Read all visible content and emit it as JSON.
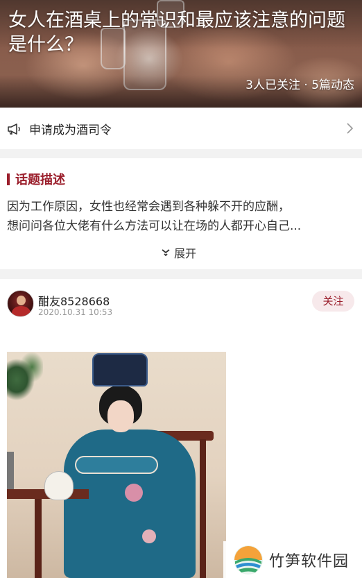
{
  "hero": {
    "title": "女人在酒桌上的常识和最应该注意的问题是什么？",
    "stats": "3人已关注 · 5篇动态"
  },
  "apply": {
    "icon": "megaphone-icon",
    "label": "申请成为酒司令"
  },
  "description": {
    "heading": "话题描述",
    "lines": [
      "因为工作原因，女性也经常会遇到各种躲不开的应酬，",
      "想问问各位大佬有什么方法可以让在场的人都开心自己..."
    ],
    "expand_label": "展开"
  },
  "post": {
    "username": "酣友8528668",
    "timestamp": "2020.10.31 10:53",
    "follow_label": "关注"
  },
  "watermark": {
    "text": "竹笋软件园"
  },
  "colors": {
    "accent": "#9b1f2c",
    "follow_bg": "#f7e9eb"
  }
}
